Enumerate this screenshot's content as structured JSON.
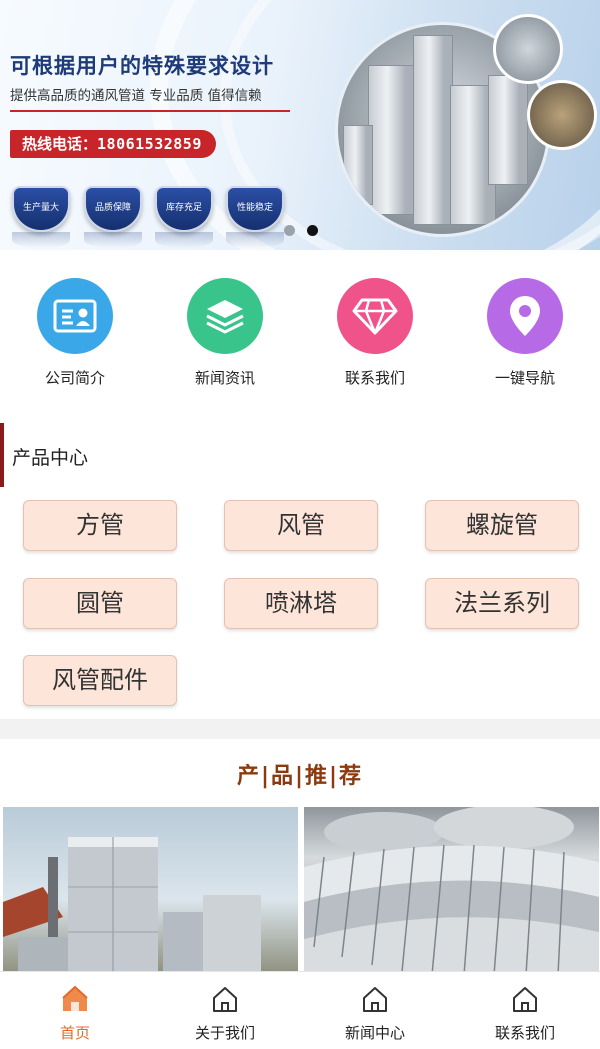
{
  "banner": {
    "title": "可根据用户的特殊要求设计",
    "subtitle": "提供高品质的通风管道 专业品质 值得信赖",
    "hotline_label": "热线电话：",
    "hotline_number": "18061532859",
    "badges": [
      "生产量大",
      "品质保障",
      "库存充足",
      "性能稳定"
    ],
    "slides_total": 2,
    "active_slide": 2
  },
  "quick_links": [
    {
      "label": "公司简介",
      "icon": "id-card-icon",
      "color": "#3aa8e8"
    },
    {
      "label": "新闻资讯",
      "icon": "layers-icon",
      "color": "#39c48c"
    },
    {
      "label": "联系我们",
      "icon": "diamond-icon",
      "color": "#f0528a"
    },
    {
      "label": "一键导航",
      "icon": "location-pin-icon",
      "color": "#b76ae6"
    }
  ],
  "product_center": {
    "title": "产品中心",
    "categories": [
      "方管",
      "风管",
      "螺旋管",
      "圆管",
      "喷淋塔",
      "法兰系列",
      "风管配件"
    ]
  },
  "recommend": {
    "title": "产|品|推|荐"
  },
  "bottom_nav": [
    {
      "label": "首页",
      "icon": "home-icon",
      "active": true
    },
    {
      "label": "关于我们",
      "icon": "home-icon",
      "active": false
    },
    {
      "label": "新闻中心",
      "icon": "home-icon",
      "active": false
    },
    {
      "label": "联系我们",
      "icon": "home-icon",
      "active": false
    }
  ],
  "colors": {
    "accent": "#e06a2c",
    "section_bar": "#8b1a1a",
    "category_bg": "#fde5d9",
    "recommend_title": "#8b3a0e"
  }
}
